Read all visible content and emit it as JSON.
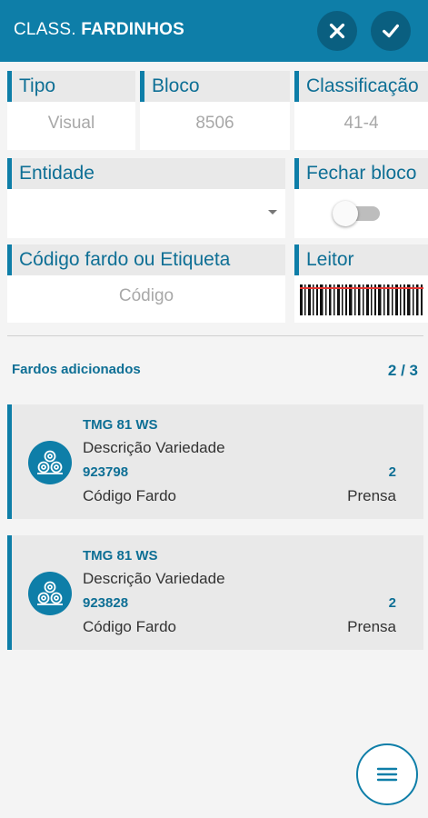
{
  "appbar": {
    "title_prefix": "CLASS.",
    "title_main": "FARDINHOS"
  },
  "fields": {
    "tipo": {
      "label": "Tipo",
      "value": "Visual"
    },
    "bloco": {
      "label": "Bloco",
      "value": "8506"
    },
    "classificacao": {
      "label": "Classificação",
      "value": "41-4"
    },
    "entidade": {
      "label": "Entidade",
      "value": ""
    },
    "fechar_bloco": {
      "label": "Fechar bloco",
      "checked": false
    },
    "codigo": {
      "label": "Código fardo ou Etiqueta",
      "placeholder": "Código"
    },
    "leitor": {
      "label": "Leitor"
    }
  },
  "list": {
    "title": "Fardos adicionados",
    "count": "2 / 3",
    "items": [
      {
        "variety_code": "TMG 81 WS",
        "variety_label": "Descrição Variedade",
        "bale_code": "923798",
        "bale_label": "Código Fardo",
        "press": "2",
        "press_label": "Prensa"
      },
      {
        "variety_code": "TMG 81 WS",
        "variety_label": "Descrição Variedade",
        "bale_code": "923828",
        "bale_label": "Código Fardo",
        "press": "2",
        "press_label": "Prensa"
      }
    ]
  },
  "colors": {
    "accent": "#0e7ea8",
    "dark_accent": "#0a5f80",
    "background": "#f4f4f4"
  },
  "icons": {
    "close": "close-icon",
    "confirm": "check-icon",
    "menu": "menu-icon",
    "bale": "cotton-bale-icon",
    "barcode": "barcode-icon"
  }
}
